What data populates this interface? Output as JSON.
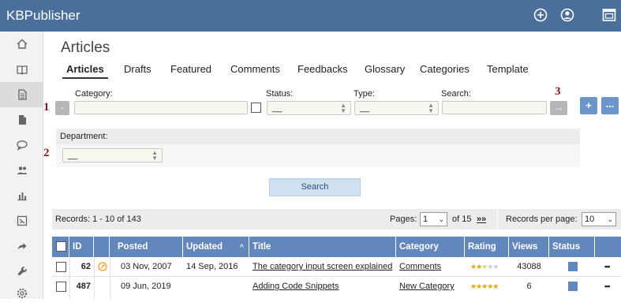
{
  "app": {
    "brand": "KBPublisher"
  },
  "topbar": {
    "icons": [
      "plus-circle-icon",
      "user-icon",
      "window-icon"
    ]
  },
  "sidebar": {
    "icons": [
      "home-icon",
      "book-icon",
      "article-icon",
      "file-icon",
      "chat-icon",
      "users-icon",
      "chart-icon",
      "report-icon",
      "share-icon",
      "wrench-icon",
      "settings-icon"
    ],
    "active_index": 2
  },
  "page": {
    "title": "Articles"
  },
  "tabs": [
    "Articles",
    "Drafts",
    "Featured",
    "Comments",
    "Feedbacks",
    "Glossary",
    "Categories",
    "Template"
  ],
  "markers": {
    "one": "1",
    "two": "2",
    "three": "3"
  },
  "filters": {
    "category_label": "Category:",
    "status_label": "Status:",
    "status_value": "__",
    "type_label": "Type:",
    "type_value": "__",
    "search_label": "Search:",
    "minus_button": "-",
    "arrow_button": "→",
    "add_button": "+",
    "more_button": "...",
    "department_label": "Department:",
    "department_value": "__",
    "search_button": "Search"
  },
  "records": {
    "summary": "Records: 1 - 10 of 143",
    "pages_label": "Pages:",
    "page_value": "1",
    "of_label": "of 15",
    "next_label": "»»",
    "per_page_label": "Records per page:",
    "per_page_value": "10"
  },
  "table": {
    "columns": [
      "ID",
      "Posted",
      "Updated",
      "Title",
      "Category",
      "Rating",
      "Views",
      "Status"
    ],
    "sort_indicator": "^",
    "rows": [
      {
        "id": "62",
        "posted": "03 Nov, 2007",
        "updated": "14 Sep, 2016",
        "title": "The category input screen explained",
        "category": "Comments",
        "rating": 2.5,
        "views": "43088",
        "status_color": "#6287bd",
        "actions": "•••",
        "draft": true
      },
      {
        "id": "487",
        "posted": "09 Jun, 2019",
        "updated": "",
        "title": "Adding Code Snippets",
        "category": "New Category",
        "rating": 5,
        "views": "6",
        "status_color": "#6287bd",
        "actions": "•••",
        "draft": false
      }
    ]
  }
}
